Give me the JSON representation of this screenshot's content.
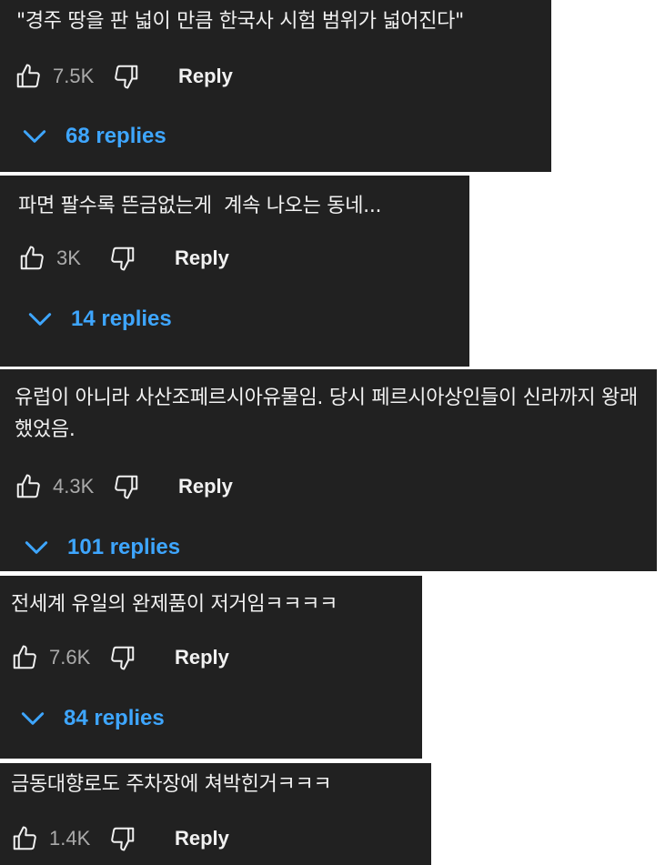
{
  "comments": [
    {
      "text": "\"경주 땅을 판 넓이 만큼 한국사 시험 범위가 넓어진다\"",
      "likes": "7.5K",
      "reply_label": "Reply",
      "replies_label": "68 replies"
    },
    {
      "text": "파면 팔수록 뜬금없는게  계속 나오는 동네...",
      "likes": "3K",
      "reply_label": "Reply",
      "replies_label": "14 replies"
    },
    {
      "text": "유럽이 아니라 사산조페르시아유물임. 당시 페르시아상인들이 신라까지 왕래했었음.",
      "likes": "4.3K",
      "reply_label": "Reply",
      "replies_label": "101 replies"
    },
    {
      "text": "전세계 유일의 완제품이 저거임ㅋㅋㅋㅋ",
      "likes": "7.6K",
      "reply_label": "Reply",
      "replies_label": "84 replies"
    },
    {
      "text": "금동대향로도 주차장에 쳐박힌거ㅋㅋㅋ",
      "likes": "1.4K",
      "reply_label": "Reply"
    }
  ],
  "colors": {
    "card_bg": "#212121",
    "text": "#f1f1f1",
    "muted": "#aaaaaa",
    "link": "#3ea6ff"
  },
  "icons": {
    "like": "thumbs-up-icon",
    "dislike": "thumbs-down-icon",
    "expand": "chevron-down-icon"
  }
}
